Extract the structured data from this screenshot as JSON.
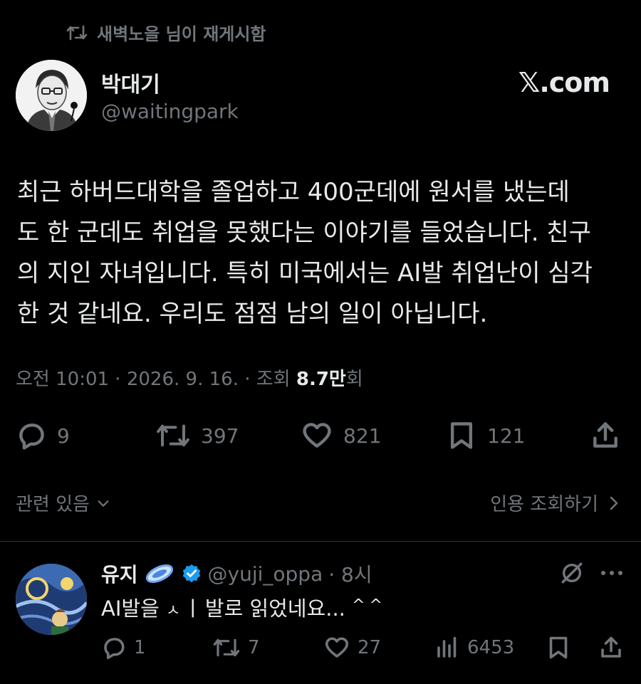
{
  "retweet_banner": {
    "text": "새벽노을 님이 재게시함",
    "icon": "repost-icon"
  },
  "author": {
    "name": "박대기",
    "handle": "@waitingpark",
    "avatar_icon": "avatar-portrait"
  },
  "brand": {
    "label": "𝕏.com"
  },
  "tweet": {
    "lines": [
      "최근 하버드대학을 졸업하고 400군데에 원서를 냈는데",
      "도 한 군데도 취업을 못했다는 이야기를 들었습니다. 친구",
      "의 지인 자녀입니다. 특히 미국에서는 AI발 취업난이 심각",
      "한 것 같네요. 우리도 점점 남의 일이 아닙니다."
    ]
  },
  "meta": {
    "time": "오전 10:01",
    "sep1": " · ",
    "date": "2026. 9. 16.",
    "sep2": " · ",
    "views_prefix": "조회 ",
    "views_value": "8.7만",
    "views_suffix": "회"
  },
  "actions": {
    "replies": "9",
    "reposts": "397",
    "likes": "821",
    "bookmarks": "121"
  },
  "related": {
    "label": "관련 있음"
  },
  "quotes": {
    "label": "인용 조회하기"
  },
  "reply": {
    "name": "유지",
    "emoji": "saturn-ring-emoji",
    "handle": "@yuji_oppa",
    "time": "· 8시",
    "text": "AI발을 ㅅㅣ발로 읽었네요... ^^",
    "text_a": "AI발을 ",
    "text_b": "ㅅ",
    "text_c": "ㅣ",
    "text_d": "발로 읽었네요... ",
    "text_e": "^^",
    "stats": {
      "replies": "1",
      "reposts": "7",
      "likes": "27",
      "views": "6453"
    }
  },
  "colors": {
    "background": "#000000",
    "text": "#e7e9ea",
    "muted": "#71767b",
    "verified": "#1d9bf0",
    "divider": "#2f3336"
  }
}
